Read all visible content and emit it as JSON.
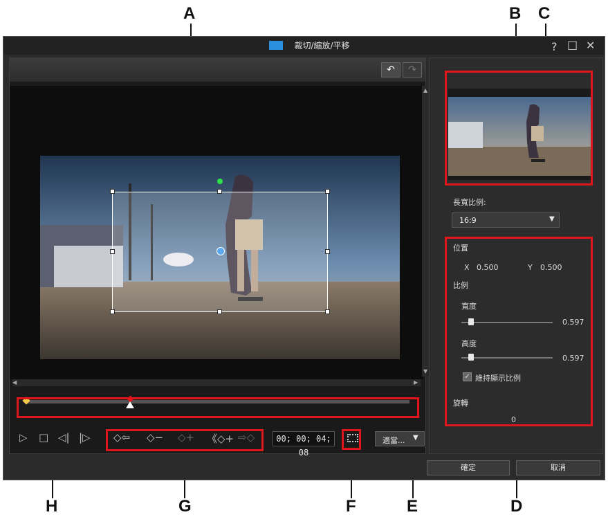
{
  "callouts": {
    "A": "A",
    "B": "B",
    "C": "C",
    "D": "D",
    "E": "E",
    "F": "F",
    "G": "G",
    "H": "H"
  },
  "window": {
    "title": "裁切/縮放/平移",
    "help": "?",
    "maximize": "□",
    "close": "✕"
  },
  "toolbar": {
    "undo": "↶",
    "redo": "↷"
  },
  "playback": {
    "play": "▷",
    "stop": "□",
    "prev_frame": "◁|",
    "next_frame": "|▷",
    "kf_prev": "◇⇦",
    "kf_remove": "◇−",
    "kf_add": "◇+",
    "kf_dup": "《◇+",
    "kf_next": "⇨◇",
    "timecode": "00; 00; 04; 08",
    "fit_label": "適當...",
    "safe_zone_icon": "safe-zone-icon"
  },
  "right": {
    "aspect_label": "長寬比例:",
    "aspect_value": "16:9",
    "position_label": "位置",
    "x_label": "X",
    "x_value": "0.500",
    "y_label": "Y",
    "y_value": "0.500",
    "scale_label": "比例",
    "width_label": "寬度",
    "width_value": "0.597",
    "height_label": "高度",
    "height_value": "0.597",
    "keep_ratio_label": "維持顯示比例",
    "keep_ratio_checked": true,
    "rotation_label": "旋轉",
    "rotation_value": "0"
  },
  "footer": {
    "ok": "確定",
    "cancel": "取消"
  },
  "colors": {
    "highlight": "#e0161b",
    "panel": "#2b2b2b",
    "keyframe": "#f2c94c"
  }
}
